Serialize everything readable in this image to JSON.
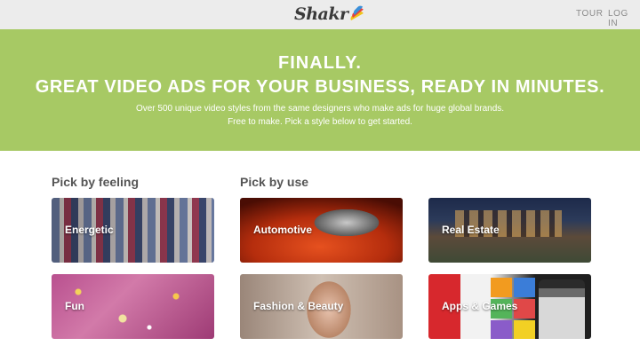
{
  "nav": {
    "logo_text": "Shakr",
    "links": [
      "TOUR",
      "LOG IN"
    ]
  },
  "hero": {
    "line1": "FINALLY.",
    "line2": "GREAT VIDEO ADS FOR YOUR BUSINESS, READY IN MINUTES.",
    "sub1": "Over 500 unique video styles from the same designers who make ads for huge global brands.",
    "sub2": "Free to make. Pick a style below to get started.",
    "bg_color": "#a7c964"
  },
  "sections": {
    "feeling_title": "Pick by feeling",
    "use_title": "Pick by use"
  },
  "tiles": [
    {
      "label": "Energetic",
      "group": "feeling"
    },
    {
      "label": "Automotive",
      "group": "use"
    },
    {
      "label": "Real Estate",
      "group": "use"
    },
    {
      "label": "Fun",
      "group": "feeling"
    },
    {
      "label": "Fashion & Beauty",
      "group": "use"
    },
    {
      "label": "Apps & Games",
      "group": "use"
    }
  ]
}
